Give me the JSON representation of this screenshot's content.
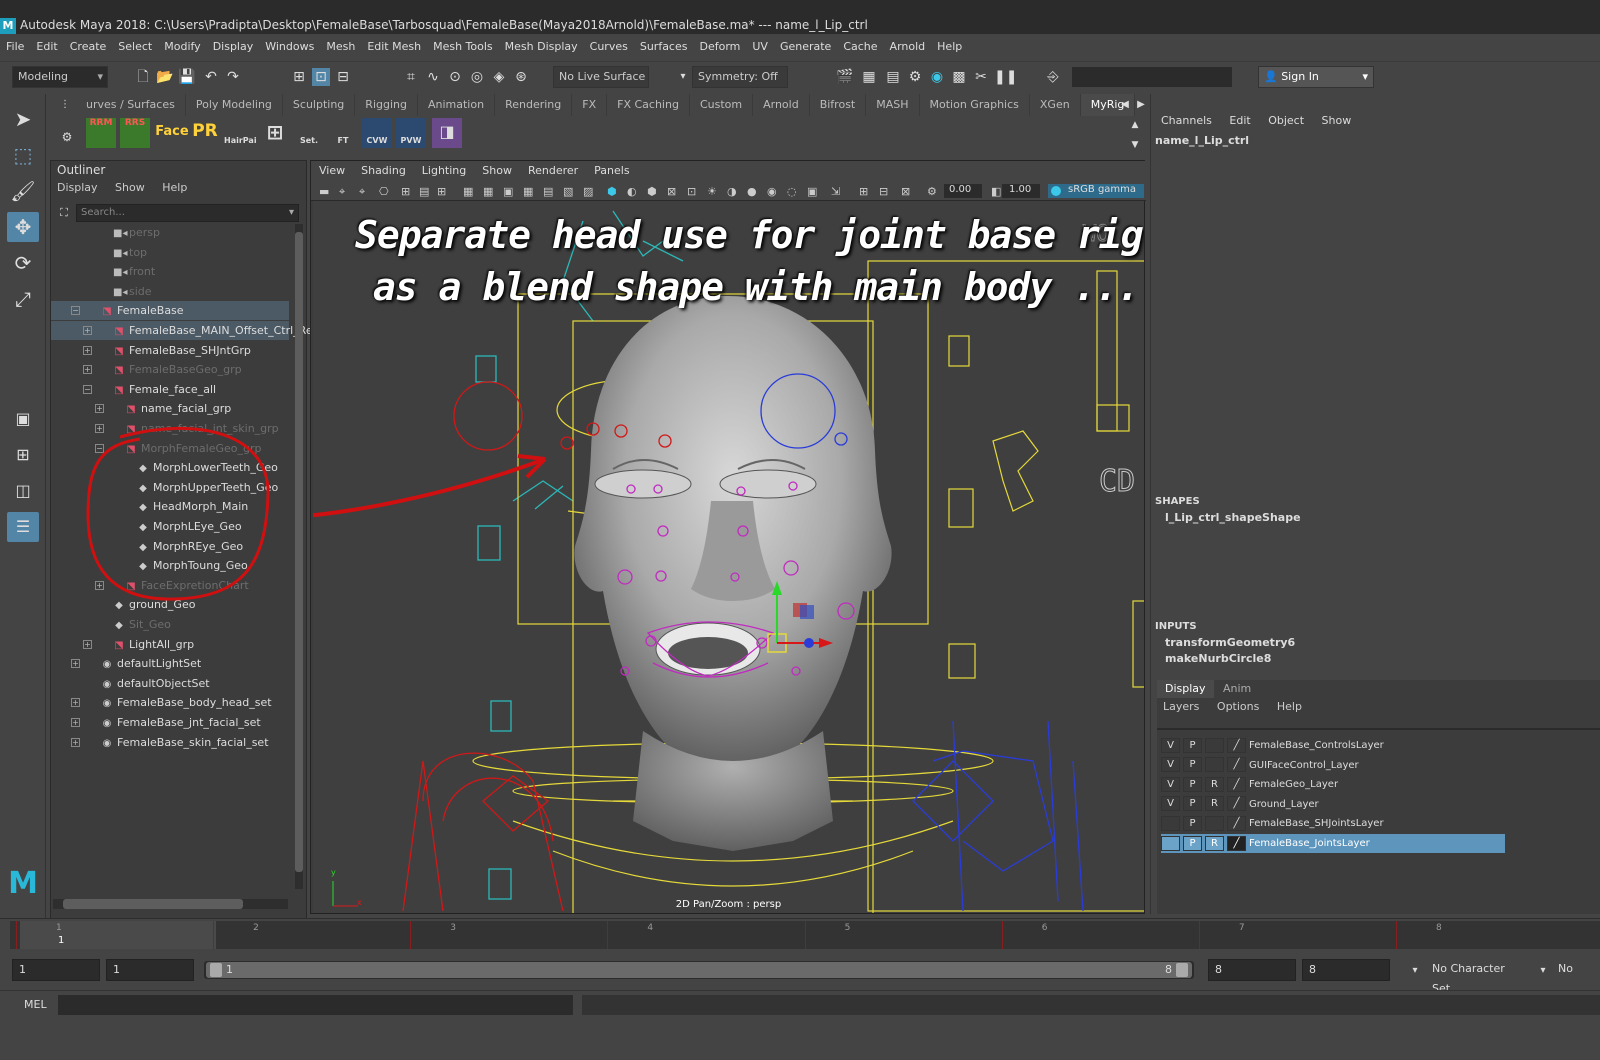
{
  "title": "Autodesk Maya 2018: C:\\Users\\Pradipta\\Desktop\\FemaleBase\\Tarbosquad\\FemaleBase(Maya2018Arnold)\\FemaleBase.ma*  ---   name_l_Lip_ctrl",
  "menu": [
    "File",
    "Edit",
    "Create",
    "Select",
    "Modify",
    "Display",
    "Windows",
    "Mesh",
    "Edit Mesh",
    "Mesh Tools",
    "Mesh Display",
    "Curves",
    "Surfaces",
    "Deform",
    "UV",
    "Generate",
    "Cache",
    "Arnold",
    "Help"
  ],
  "status": {
    "workspace": "Modeling",
    "live_surface": "No Live Surface",
    "symmetry": "Symmetry: Off",
    "sign_in": "Sign In"
  },
  "shelf": {
    "tabs": [
      "urves / Surfaces",
      "Poly Modeling",
      "Sculpting",
      "Rigging",
      "Animation",
      "Rendering",
      "FX",
      "FX Caching",
      "Custom",
      "Arnold",
      "Bifrost",
      "MASH",
      "Motion Graphics",
      "XGen",
      "MyRig"
    ],
    "active": "MyRig",
    "buttons": [
      "RRM",
      "RRS",
      "Face",
      "PR",
      "HairPai",
      "Set.",
      "FT",
      "CVW",
      "PVW"
    ]
  },
  "outliner": {
    "title": "Outliner",
    "menu": [
      "Display",
      "Show",
      "Help"
    ],
    "search_placeholder": "Search...",
    "items": [
      {
        "label": "persp",
        "depth": 2,
        "dim": true,
        "icon": "camera-icon"
      },
      {
        "label": "top",
        "depth": 2,
        "dim": true,
        "icon": "camera-icon"
      },
      {
        "label": "front",
        "depth": 2,
        "dim": true,
        "icon": "camera-icon"
      },
      {
        "label": "side",
        "depth": 2,
        "dim": true,
        "icon": "camera-icon"
      },
      {
        "label": "FemaleBase",
        "depth": 1,
        "dim": false,
        "icon": "group-icon",
        "expanded": true,
        "selected": true
      },
      {
        "label": "FemaleBase_MAIN_Offset_Ctrl_Rest",
        "depth": 2,
        "dim": false,
        "icon": "group-icon",
        "collapsed": true,
        "selected": true
      },
      {
        "label": "FemaleBase_SHJntGrp",
        "depth": 2,
        "dim": false,
        "icon": "group-icon",
        "collapsed": true
      },
      {
        "label": "FemaleBaseGeo_grp",
        "depth": 2,
        "dim": true,
        "icon": "group-icon",
        "collapsed": true
      },
      {
        "label": "Female_face_all",
        "depth": 2,
        "dim": false,
        "icon": "group-icon",
        "expanded": true
      },
      {
        "label": "name_facial_grp",
        "depth": 3,
        "dim": false,
        "icon": "group-icon",
        "collapsed": true
      },
      {
        "label": "name_facial_jnt_skin_grp",
        "depth": 3,
        "dim": true,
        "icon": "group-icon",
        "collapsed": true
      },
      {
        "label": "MorphFemaleGeo_grp",
        "depth": 3,
        "dim": true,
        "icon": "group-icon",
        "expanded": true
      },
      {
        "label": "MorphLowerTeeth_Geo",
        "depth": 4,
        "dim": false,
        "icon": "mesh-icon"
      },
      {
        "label": "MorphUpperTeeth_Geo",
        "depth": 4,
        "dim": false,
        "icon": "mesh-icon"
      },
      {
        "label": "HeadMorph_Main",
        "depth": 4,
        "dim": false,
        "icon": "mesh-icon"
      },
      {
        "label": "MorphLEye_Geo",
        "depth": 4,
        "dim": false,
        "icon": "mesh-icon"
      },
      {
        "label": "MorphREye_Geo",
        "depth": 4,
        "dim": false,
        "icon": "mesh-icon"
      },
      {
        "label": "MorphToung_Geo",
        "depth": 4,
        "dim": false,
        "icon": "mesh-icon"
      },
      {
        "label": "FaceExpretionChart",
        "depth": 3,
        "dim": true,
        "icon": "group-icon",
        "collapsed": true
      },
      {
        "label": "ground_Geo",
        "depth": 2,
        "dim": false,
        "icon": "mesh-icon"
      },
      {
        "label": "Sit_Geo",
        "depth": 2,
        "dim": true,
        "icon": "mesh-icon"
      },
      {
        "label": "LightAll_grp",
        "depth": 2,
        "dim": false,
        "icon": "group-icon",
        "collapsed": true
      },
      {
        "label": "defaultLightSet",
        "depth": 1,
        "dim": false,
        "icon": "set-icon",
        "collapsed": true
      },
      {
        "label": "defaultObjectSet",
        "depth": 1,
        "dim": false,
        "icon": "set-icon"
      },
      {
        "label": "FemaleBase_body_head_set",
        "depth": 1,
        "dim": false,
        "icon": "set-icon",
        "collapsed": true
      },
      {
        "label": "FemaleBase_jnt_facial_set",
        "depth": 1,
        "dim": false,
        "icon": "set-icon",
        "collapsed": true
      },
      {
        "label": "FemaleBase_skin_facial_set",
        "depth": 1,
        "dim": false,
        "icon": "set-icon",
        "collapsed": true
      }
    ]
  },
  "viewport": {
    "menu": [
      "View",
      "Shading",
      "Lighting",
      "Show",
      "Renderer",
      "Panels"
    ],
    "near": "0.00",
    "far": "1.00",
    "colorspace": "sRGB gamma",
    "footer": "2D Pan/Zoom : persp",
    "overlay_line1": "Separate head use for joint base rig ..and attach",
    "overlay_line2": "as a blend shape with main body ..."
  },
  "channels": {
    "menu": [
      "Channels",
      "Edit",
      "Object",
      "Show"
    ],
    "object": "name_l_Lip_ctrl",
    "shapes_label": "SHAPES",
    "shape": "l_Lip_ctrl_shapeShape",
    "inputs_label": "INPUTS",
    "inputs": [
      "transformGeometry6",
      "makeNurbCircle8"
    ]
  },
  "layers": {
    "tabs": [
      "Display",
      "Anim"
    ],
    "active_tab": "Display",
    "menu": [
      "Layers",
      "Options",
      "Help"
    ],
    "rows": [
      {
        "v": "V",
        "p": "P",
        "r": "",
        "name": "FemaleBase_ControlsLayer"
      },
      {
        "v": "V",
        "p": "P",
        "r": "",
        "name": "GUIFaceControl_Layer"
      },
      {
        "v": "V",
        "p": "P",
        "r": "R",
        "name": "FemaleGeo_Layer"
      },
      {
        "v": "V",
        "p": "P",
        "r": "R",
        "name": "Ground_Layer"
      },
      {
        "v": "",
        "p": "P",
        "r": "",
        "name": "FemaleBase_SHJointsLayer"
      },
      {
        "v": "",
        "p": "P",
        "r": "R",
        "name": "FemaleBase_JointsLayer",
        "selected": true
      }
    ]
  },
  "timeline": {
    "ticks": [
      "1",
      "2",
      "3",
      "4",
      "5",
      "6",
      "7",
      "8"
    ],
    "current": "1"
  },
  "range": {
    "start": "1",
    "play_start": "1",
    "slider_start": "1",
    "slider_end": "8",
    "play_end": "8",
    "end": "8",
    "character_set": "No Character Set",
    "extra": "No"
  },
  "command": {
    "label": "MEL"
  },
  "colors": {
    "accent": "#5285a6",
    "annotation_red": "#d01010",
    "rig_yellow": "#e5d93a",
    "rig_blue": "#2a3cd8",
    "rig_magenta": "#c02bc0",
    "rig_cyan": "#2cb8b8"
  }
}
